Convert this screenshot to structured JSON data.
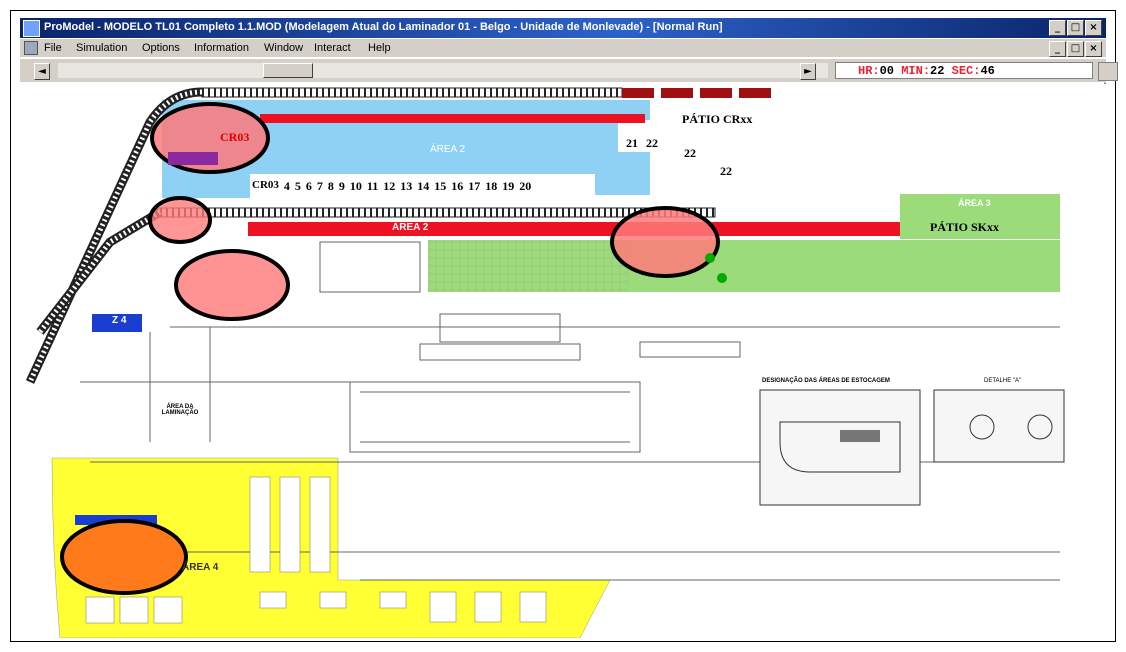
{
  "window": {
    "title": "ProModel - MODELO TL01 Completo 1.1.MOD (Modelagem Atual do Laminador 01 - Belgo - Unidade de Monlevade) - [Normal Run]",
    "buttons": [
      "_",
      "□",
      "×"
    ]
  },
  "menu": {
    "items": [
      "File",
      "Simulation",
      "Options",
      "Information",
      "Window",
      "Interact",
      "Help"
    ]
  },
  "clock": {
    "hr_label": "HR:",
    "hr": "00",
    "min_label": "MIN:",
    "min": "22",
    "sec_label": "SEC:",
    "sec": "46"
  },
  "layout": {
    "patio_crxx": "PÁTIO CRxx",
    "patio_skxx": "PÁTIO SKxx",
    "cr03": "CR03",
    "area2_top": "ÁREA 2",
    "area2_bar": "ÁREA 2",
    "area3": "ÁREA 3",
    "area4": "ÁREA 4",
    "z4": "Z 4",
    "area_laminacao": "ÁREA DA LAMINAÇÃO",
    "designacao": "DESIGNAÇÃO DAS ÁREAS DE ESTOCAGEM",
    "detalhe": "DETALHE \"A\"",
    "bay_numbers_top": [
      "21",
      "22"
    ],
    "bay_22_a": "22",
    "bay_22_b": "22",
    "bay_row": [
      "CR03",
      "4",
      "5",
      "6",
      "7",
      "8",
      "9",
      "10",
      "11",
      "12",
      "13",
      "14",
      "15",
      "16",
      "17",
      "18",
      "19",
      "20"
    ]
  }
}
